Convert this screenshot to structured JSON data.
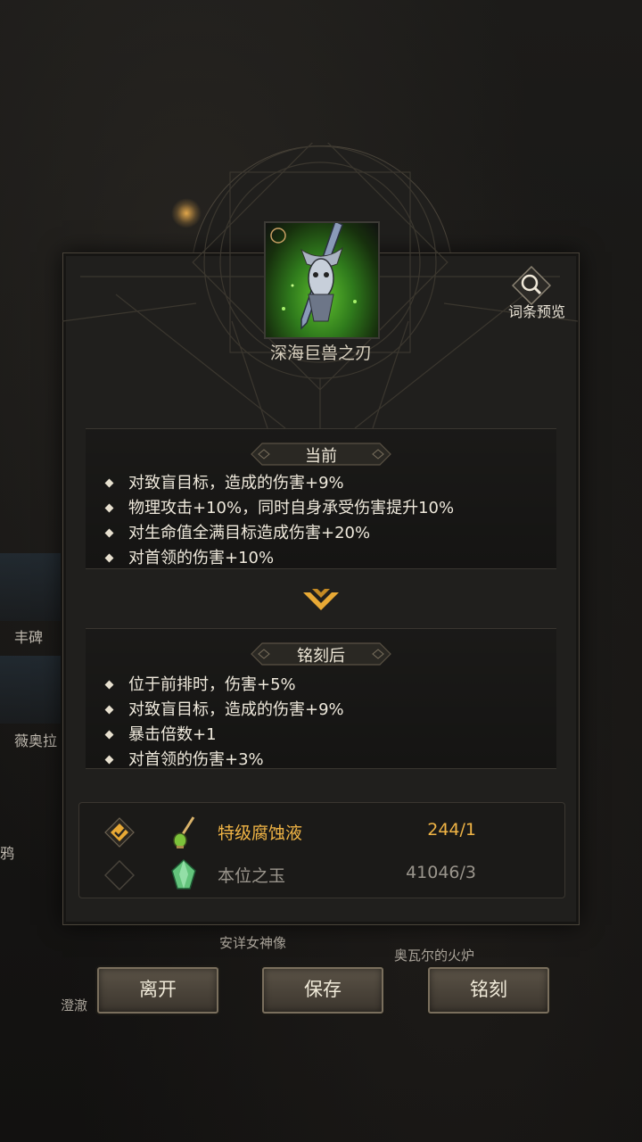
{
  "background": {
    "labels": [
      "丰碑",
      "薇奥拉",
      "鸦",
      "安详女神像",
      "奥瓦尔的火炉",
      "澄澈"
    ]
  },
  "item": {
    "name": "深海巨兽之刃",
    "icon": "sword-icon"
  },
  "preview": {
    "label": "词条预览",
    "icon": "magnifier-icon"
  },
  "current": {
    "title": "当前",
    "lines": [
      "对致盲目标，造成的伤害+9%",
      "物理攻击+10%，同时自身承受伤害提升10%",
      "对生命值全满目标造成伤害+20%",
      "对首领的伤害+10%"
    ]
  },
  "after": {
    "title": "铭刻后",
    "lines": [
      "位于前排时，伤害+5%",
      "对致盲目标，造成的伤害+9%",
      "暴击倍数+1",
      "对首领的伤害+3%"
    ]
  },
  "materials": [
    {
      "name": "特级腐蚀液",
      "count": "244/1",
      "checked": true,
      "icon": "potion-icon",
      "color": "#f0b445"
    },
    {
      "name": "本位之玉",
      "count": "41046/3",
      "checked": false,
      "icon": "jade-crystal-icon",
      "color": "#9a958c"
    }
  ],
  "buttons": {
    "leave": "离开",
    "save": "保存",
    "inscribe": "铭刻"
  },
  "colors": {
    "accent_gold": "#f0b445",
    "panel_bg": "#201f1d",
    "border": "#4a443a"
  }
}
